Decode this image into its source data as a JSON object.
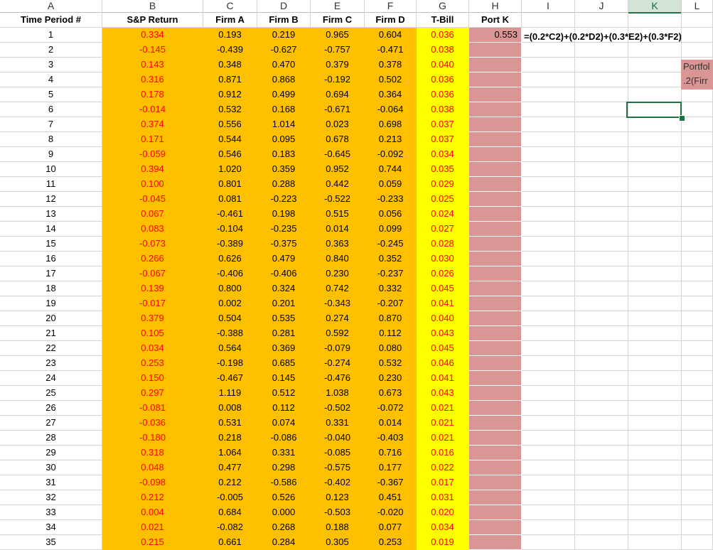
{
  "columns": [
    "A",
    "B",
    "C",
    "D",
    "E",
    "F",
    "G",
    "H",
    "I",
    "J",
    "K",
    "L"
  ],
  "selected_column": "K",
  "headers": {
    "time_period": "Time Period #",
    "sp_return": "S&P Return",
    "firm_a": "Firm A",
    "firm_b": "Firm B",
    "firm_c": "Firm C",
    "firm_d": "Firm D",
    "tbill": "T-Bill",
    "port_k": "Port K"
  },
  "port_k_value": "0.553",
  "port_k_formula": "=(0.2*C2)+(0.2*D2)+(0.3*E2)+(0.3*F2)",
  "note_lines": [
    "Portfol",
    ".2(Firr"
  ],
  "colors": {
    "orange": "#ffc000",
    "yellow": "#ffff00",
    "pink": "#da9694",
    "red_text": "#ff0000",
    "excel_green": "#217346"
  },
  "rows": [
    [
      "1",
      "0.334",
      "0.193",
      "0.219",
      "0.965",
      "0.604",
      "0.036"
    ],
    [
      "2",
      "-0.145",
      "-0.439",
      "-0.627",
      "-0.757",
      "-0.471",
      "0.038"
    ],
    [
      "3",
      "0.143",
      "0.348",
      "0.470",
      "0.379",
      "0.378",
      "0.040"
    ],
    [
      "4",
      "0.316",
      "0.871",
      "0.868",
      "-0.192",
      "0.502",
      "0.036"
    ],
    [
      "5",
      "0.178",
      "0.912",
      "0.499",
      "0.694",
      "0.364",
      "0.036"
    ],
    [
      "6",
      "-0.014",
      "0.532",
      "0.168",
      "-0.671",
      "-0.064",
      "0.038"
    ],
    [
      "7",
      "0.374",
      "0.556",
      "1.014",
      "0.023",
      "0.698",
      "0.037"
    ],
    [
      "8",
      "0.171",
      "0.544",
      "0.095",
      "0.678",
      "0.213",
      "0.037"
    ],
    [
      "9",
      "-0.059",
      "0.546",
      "0.183",
      "-0.645",
      "-0.092",
      "0.034"
    ],
    [
      "10",
      "0.394",
      "1.020",
      "0.359",
      "0.952",
      "0.744",
      "0.035"
    ],
    [
      "11",
      "0.100",
      "0.801",
      "0.288",
      "0.442",
      "0.059",
      "0.029"
    ],
    [
      "12",
      "-0.045",
      "0.081",
      "-0.223",
      "-0.522",
      "-0.233",
      "0.025"
    ],
    [
      "13",
      "0.067",
      "-0.461",
      "0.198",
      "0.515",
      "0.056",
      "0.024"
    ],
    [
      "14",
      "0.083",
      "-0.104",
      "-0.235",
      "0.014",
      "0.099",
      "0.027"
    ],
    [
      "15",
      "-0.073",
      "-0.389",
      "-0.375",
      "0.363",
      "-0.245",
      "0.028"
    ],
    [
      "16",
      "0.266",
      "0.626",
      "0.479",
      "0.840",
      "0.352",
      "0.030"
    ],
    [
      "17",
      "-0.067",
      "-0.406",
      "-0.406",
      "0.230",
      "-0.237",
      "0.026"
    ],
    [
      "18",
      "0.139",
      "0.800",
      "0.324",
      "0.742",
      "0.332",
      "0.045"
    ],
    [
      "19",
      "-0.017",
      "0.002",
      "0.201",
      "-0.343",
      "-0.207",
      "0.041"
    ],
    [
      "20",
      "0.379",
      "0.504",
      "0.535",
      "0.274",
      "0.870",
      "0.040"
    ],
    [
      "21",
      "0.105",
      "-0.388",
      "0.281",
      "0.592",
      "0.112",
      "0.043"
    ],
    [
      "22",
      "0.034",
      "0.564",
      "0.369",
      "-0.079",
      "0.080",
      "0.045"
    ],
    [
      "23",
      "0.253",
      "-0.198",
      "0.685",
      "-0.274",
      "0.532",
      "0.046"
    ],
    [
      "24",
      "0.150",
      "-0.467",
      "0.145",
      "-0.476",
      "0.230",
      "0.041"
    ],
    [
      "25",
      "0.297",
      "1.119",
      "0.512",
      "1.038",
      "0.673",
      "0.043"
    ],
    [
      "26",
      "-0.081",
      "0.008",
      "0.112",
      "-0.502",
      "-0.072",
      "0.021"
    ],
    [
      "27",
      "-0.036",
      "0.531",
      "0.074",
      "0.331",
      "0.014",
      "0.021"
    ],
    [
      "28",
      "-0.180",
      "0.218",
      "-0.086",
      "-0.040",
      "-0.403",
      "0.021"
    ],
    [
      "29",
      "0.318",
      "1.064",
      "0.331",
      "-0.085",
      "0.716",
      "0.016"
    ],
    [
      "30",
      "0.048",
      "0.477",
      "0.298",
      "-0.575",
      "0.177",
      "0.022"
    ],
    [
      "31",
      "-0.098",
      "0.212",
      "-0.586",
      "-0.402",
      "-0.367",
      "0.017"
    ],
    [
      "32",
      "0.212",
      "-0.005",
      "0.526",
      "0.123",
      "0.451",
      "0.031"
    ],
    [
      "33",
      "0.004",
      "0.684",
      "0.000",
      "-0.503",
      "-0.020",
      "0.020"
    ],
    [
      "34",
      "0.021",
      "-0.082",
      "0.268",
      "0.188",
      "0.077",
      "0.034"
    ],
    [
      "35",
      "0.215",
      "0.661",
      "0.284",
      "0.305",
      "0.253",
      "0.019"
    ]
  ]
}
